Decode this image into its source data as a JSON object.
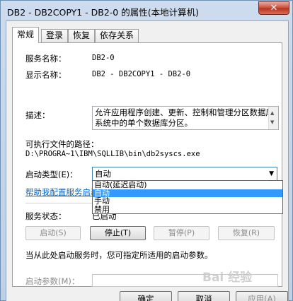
{
  "window": {
    "title": "DB2 - DB2COPY1 - DB2-0 的属性(本地计算机)",
    "close_glyph": "✕"
  },
  "tabs": [
    {
      "label": "常规",
      "active": true
    },
    {
      "label": "登录"
    },
    {
      "label": "恢复"
    },
    {
      "label": "依存关系"
    }
  ],
  "general": {
    "service_name_label": "服务名称：",
    "service_name_value": "DB2-0",
    "display_name_label": "显示名称：",
    "display_name_value": "DB2 - DB2COPY1 - DB2-0",
    "description_label": "描述：",
    "description_value": "允许应用程序创建、更新、控制和管理分区数据库系统中的单个数据库分区。",
    "exe_path_label": "可执行文件的路径：",
    "exe_path_value": "D:\\PROGRA~1\\IBM\\SQLLIB\\bin\\db2syscs.exe",
    "startup_type_label": "启动类型(E)：",
    "startup_type_value": "自动",
    "startup_options": [
      "自动(延迟启动)",
      "自动",
      "手动",
      "禁用"
    ],
    "help_link": "帮助我配置服务启动",
    "service_status_label": "服务状态：",
    "service_status_value": "已启动",
    "buttons": {
      "start": "启动(S)",
      "stop": "停止(T)",
      "pause": "暂停(P)",
      "resume": "恢复(R)"
    },
    "start_hint": "当从此处启动服务时，您可指定所适用的启动参数。",
    "start_params_label": "启动参数(M)："
  },
  "footer": {
    "ok": "确定",
    "cancel": "取消",
    "apply": "应用(A)"
  },
  "watermark": "Bai 经验",
  "icons": {
    "dropdown": "chevron-down-icon",
    "scroll_up": "arrow-up-icon",
    "scroll_down": "arrow-down-icon"
  },
  "colors": {
    "selection": "#3399ff",
    "link": "#0066cc"
  }
}
